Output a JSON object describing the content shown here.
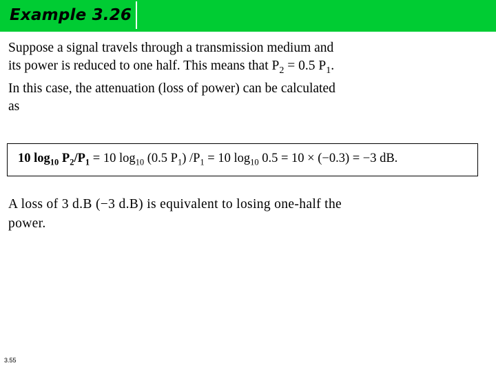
{
  "header": {
    "title": "Example 3.26",
    "band_color": "#00CC33"
  },
  "body": {
    "paragraph_line1": "Suppose a signal travels through a transmission medium and",
    "paragraph_line2_a": "its power is reduced to one half. This means that P",
    "paragraph_line2_sub": "2",
    "paragraph_line2_b": " = 0.5 P",
    "paragraph_line2_sub2": "1",
    "paragraph_line2_c": ".",
    "paragraph_line3": "In this case, the attenuation (loss of power) can be calculated",
    "paragraph_line4": "as"
  },
  "formula": {
    "part1": "10 log",
    "sub1": "10",
    "part2": " P",
    "sub2": "2",
    "part3": "/P",
    "sub3": "1",
    "part4": " = 10 log",
    "sub4": "10",
    "part5": " (0.5 P",
    "sub5": "1",
    "part6": ") /P",
    "sub6": "1",
    "part7": " = 10 log",
    "sub7": "10",
    "part8": " 0.5 = 10 × (−0.3) = −3 dB."
  },
  "closing": {
    "line1": "A loss of 3 d.B (−3 d.B) is equivalent to losing one-half the",
    "line2": "power."
  },
  "footer": {
    "page_number": "3.55"
  }
}
